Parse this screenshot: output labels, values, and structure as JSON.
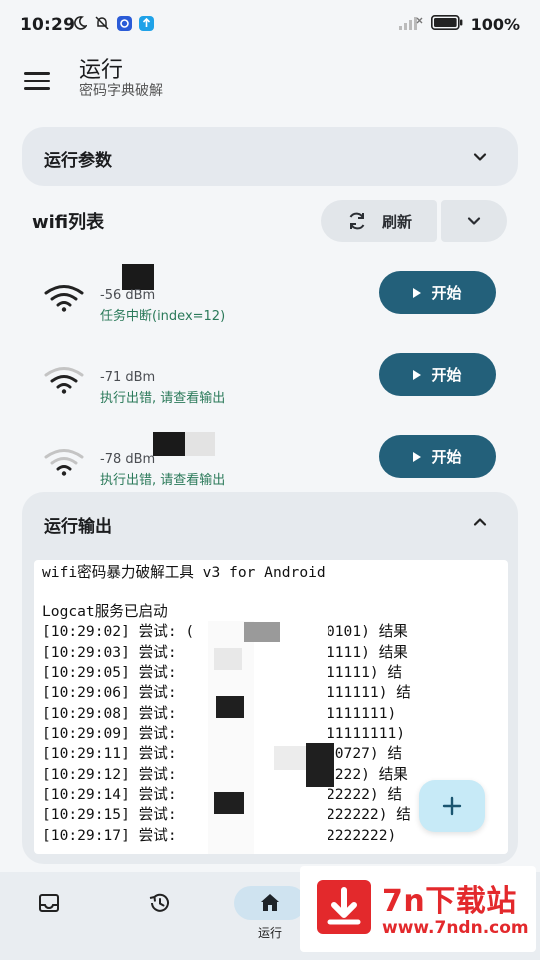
{
  "status_bar": {
    "time": "10:29",
    "battery": "100%",
    "icons": [
      "moon-icon",
      "mute-bell-icon",
      "app-badge-icon",
      "upload-badge-icon",
      "signal-icon",
      "battery-icon"
    ]
  },
  "app_bar": {
    "title": "运行",
    "subtitle": "密码字典破解"
  },
  "params_card": {
    "title": "运行参数"
  },
  "wifi_list": {
    "header": "wifi列表",
    "refresh_label": "刷新",
    "networks": [
      {
        "dbm": "-56 dBm",
        "status": "任务中断(index=12)",
        "signal_level": "strong",
        "button": "开始"
      },
      {
        "dbm": "-71 dBm",
        "status": "执行出错, 请查看输出",
        "signal_level": "medium",
        "button": "开始"
      },
      {
        "dbm": "-78 dBm",
        "status": "执行出错, 请查看输出",
        "signal_level": "weak",
        "button": "开始"
      }
    ]
  },
  "output": {
    "title": "运行输出",
    "lines": [
      "wifi密码暴力破解工具 v3 for Android",
      "",
      "Logcat服务已启动",
      "[10:29:02] 尝试: (        Z, 01010101) 结果",
      "[10:29:03] 尝试:          Z, 11111111) 结果",
      "[10:29:05] 尝试:          Z, 111111111) 结",
      "[10:29:06] 尝试:          Z, 1111111111) 结",
      "[10:29:08] 尝试:          Z, 11111111111)",
      "[10:29:09] 尝试:          Z, 111111111111)",
      "[10:29:11] 尝试:          Z, XTN960727) 结",
      "[10:29:12] 尝试:          Z, 22222222) 结果",
      "[10:29:14] 尝试:          Z, 222222222) 结",
      "[10:29:15] 尝试:          Z, 2222222222) 结",
      "[10:29:17] 尝试:          Z, 22222222222)"
    ]
  },
  "bottom_nav": {
    "items": [
      {
        "icon": "inbox-icon",
        "label": ""
      },
      {
        "icon": "history-icon",
        "label": ""
      },
      {
        "icon": "home-icon",
        "label": "运行",
        "active": true
      }
    ]
  },
  "watermark": {
    "title": "7n下载站",
    "url": "www.7ndn.com"
  },
  "colors": {
    "accent": "#23607a",
    "status_text": "#2b7a5a",
    "fab": "#c7eaf7",
    "watermark": "#e3292c"
  }
}
